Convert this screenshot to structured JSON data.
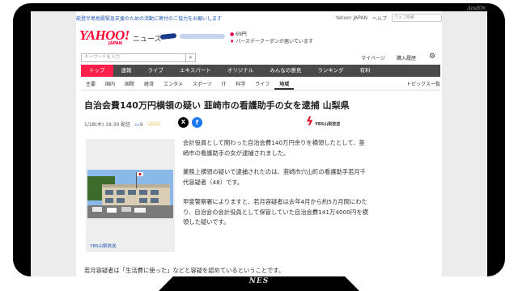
{
  "header": {
    "notice": "能登半島地震緊急支援のための活動に寄付のご協力をお願いします",
    "links": [
      "Yahoo! JAPAN",
      "ヘルプ"
    ],
    "search_placeholder": "ウェブ検索",
    "logo": "YAHOO!",
    "logo_sub": "JAPAN",
    "service": "ニュース",
    "points_value": "69円",
    "points_message": "バースデークーポンが届いています"
  },
  "searchbar": {
    "placeholder": "キーワードを入力",
    "button_icon": "search-icon",
    "mypage": "マイページ",
    "history": "購入履歴"
  },
  "nav": {
    "items": [
      {
        "label": "トップ"
      },
      {
        "label": "速報"
      },
      {
        "label": "ライブ"
      },
      {
        "label": "エキスパート"
      },
      {
        "label": "オリジナル"
      },
      {
        "label": "みんなの意見"
      },
      {
        "label": "ランキング"
      },
      {
        "label": "有料"
      }
    ],
    "active_color": "#ff1f4b"
  },
  "subnav": {
    "items": [
      {
        "label": "主要"
      },
      {
        "label": "国内"
      },
      {
        "label": "国際"
      },
      {
        "label": "経済"
      },
      {
        "label": "エンタメ"
      },
      {
        "label": "スポーツ"
      },
      {
        "label": "IT"
      },
      {
        "label": "科学"
      },
      {
        "label": "ライフ"
      },
      {
        "label": "地域"
      }
    ],
    "topics": "トピックス一覧"
  },
  "article": {
    "title": "自治会費140万円横領の疑い 韮崎市の看護助手の女を逮捕 山梨県",
    "date": "1/18(木) 19:30 配信",
    "comments": "9",
    "source": "YBS山梨放送",
    "photo_caption": "YBS山梨放送",
    "paragraphs": [
      "会計役員として関わった自治会費140万円余りを横領したとして、韮崎市の看護助手の女が逮捕されました。",
      "業務上横領の疑いで逮捕されたのは、韮崎市穴山町の看護助手若月千代容疑者（48）です。",
      "甲斐警察署によりますと、若月容疑者は去年4月から約5カ月間にわたり、自治会の会計役員として保管していた自治会費141万4000円を横領した疑いです。"
    ],
    "final_paragraph": "若月容疑者は「生活費に使った」などと容疑を認めているということです。"
  },
  "frame": {
    "brand_top": "AmdOn",
    "brand_bottom": "NES"
  }
}
